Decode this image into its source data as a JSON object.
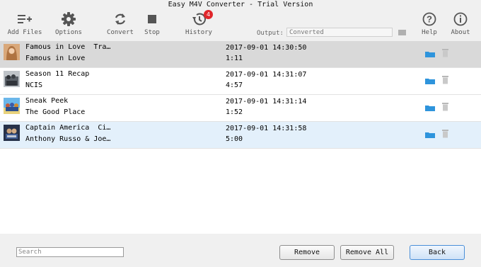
{
  "window": {
    "title": "Easy M4V Converter - Trial Version"
  },
  "toolbar": {
    "add_files": "Add Files",
    "options": "Options",
    "convert": "Convert",
    "stop": "Stop",
    "history": "History",
    "history_badge": "4",
    "help": "Help",
    "about": "About",
    "output_label": "Output:",
    "output_value": "Converted"
  },
  "items": [
    {
      "title": "Famous in Love  Tra…",
      "subtitle": "Famous in Love",
      "date": "2017-09-01 14:30:50",
      "duration": "1:11"
    },
    {
      "title": "Season 11 Recap",
      "subtitle": "NCIS",
      "date": "2017-09-01 14:31:07",
      "duration": "4:57"
    },
    {
      "title": "Sneak Peek",
      "subtitle": "The Good Place",
      "date": "2017-09-01 14:31:14",
      "duration": "1:52"
    },
    {
      "title": "Captain America  Ci…",
      "subtitle": "Anthony Russo & Joe…",
      "date": "2017-09-01 14:31:58",
      "duration": "5:00"
    }
  ],
  "footer": {
    "search_placeholder": "Search",
    "remove": "Remove",
    "remove_all": "Remove All",
    "back": "Back"
  },
  "colors": {
    "accent": "#1e88d8",
    "badge": "#e0262b",
    "selected_row": "#d9d9d9",
    "highlight_row": "#e3f0fb"
  }
}
